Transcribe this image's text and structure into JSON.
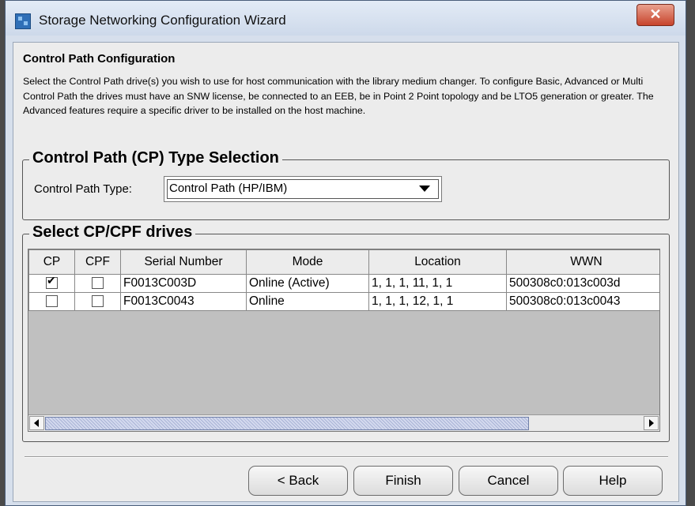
{
  "window": {
    "title": "Storage Networking Configuration Wizard",
    "close_glyph": "✕"
  },
  "page": {
    "title": "Control Path Configuration",
    "description": "Select the Control Path drive(s) you wish to use for host communication with the library medium changer. To configure Basic, Advanced or Multi Control Path the drives must have an SNW license, be connected to an EEB, be in Point 2 Point topology and be LTO5 generation or greater. The Advanced features require a specific driver to be installed on the host machine."
  },
  "cp_type_group": {
    "legend": "Control Path (CP) Type Selection",
    "label": "Control Path Type:",
    "selected": "Control Path (HP/IBM)"
  },
  "drives_group": {
    "legend": "Select CP/CPF drives",
    "columns": [
      "CP",
      "CPF",
      "Serial Number",
      "Mode",
      "Location",
      "WWN"
    ],
    "rows": [
      {
        "cp": true,
        "cpf": false,
        "serial": "F0013C003D",
        "mode": "Online (Active)",
        "location": "1, 1, 1, 11, 1, 1",
        "wwn": "500308c0:013c003d"
      },
      {
        "cp": false,
        "cpf": false,
        "serial": "F0013C0043",
        "mode": "Online",
        "location": "1, 1, 1, 12, 1, 1",
        "wwn": "500308c0:013c0043"
      }
    ]
  },
  "buttons": {
    "back": "< Back",
    "finish": "Finish",
    "cancel": "Cancel",
    "help": "Help"
  }
}
